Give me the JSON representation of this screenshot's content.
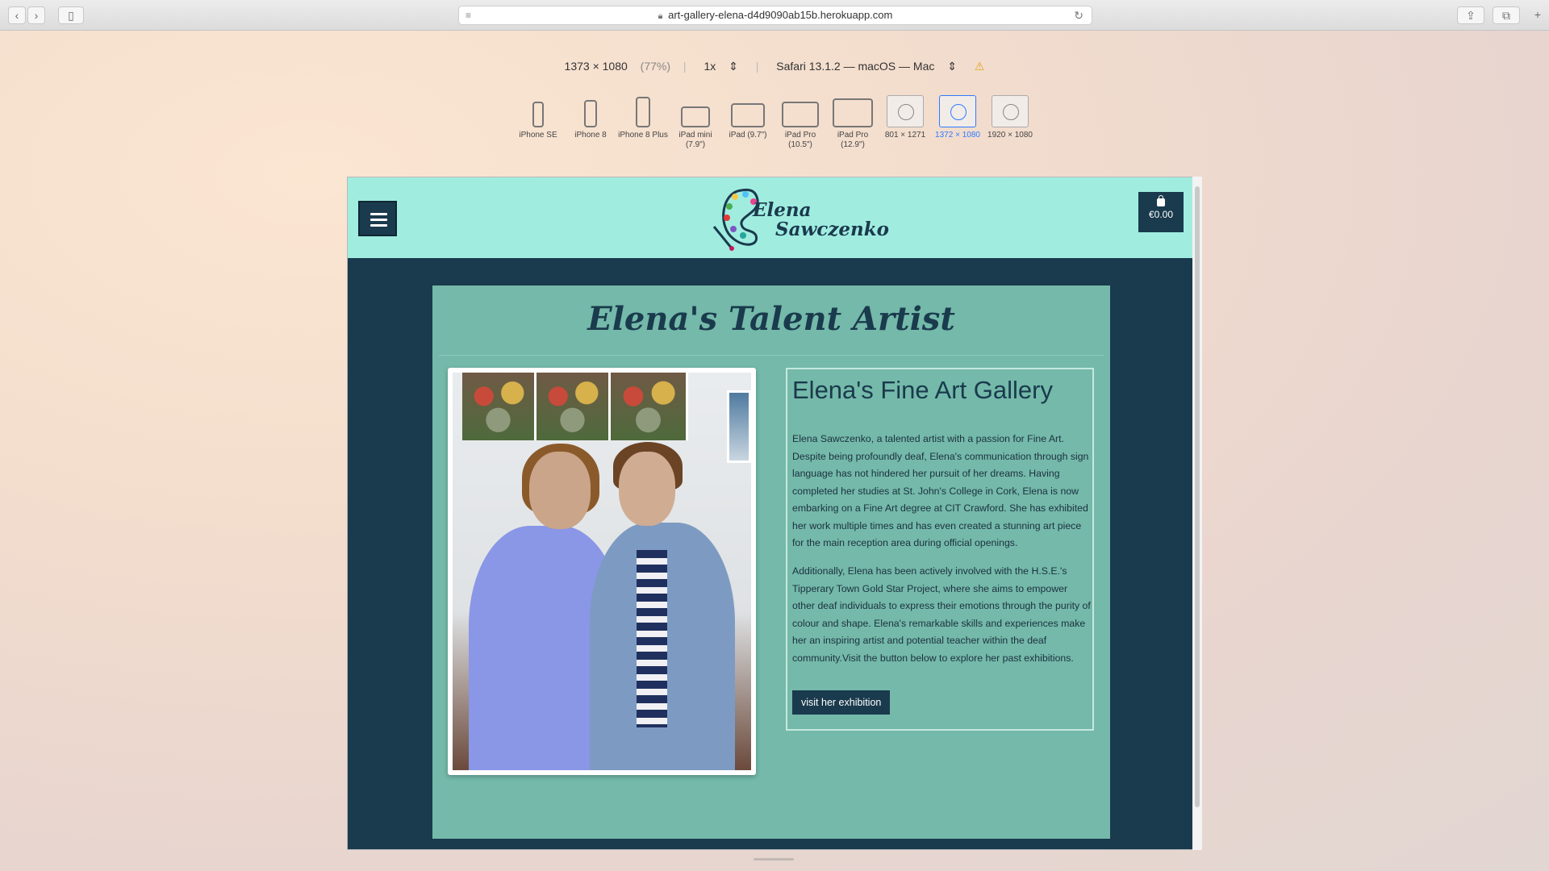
{
  "browser": {
    "url": "art-gallery-elena-d4d9090ab15b.herokuapp.com"
  },
  "responsive": {
    "dimensions": "1373 × 1080",
    "zoom": "(77%)",
    "scale": "1x",
    "user_agent": "Safari 13.1.2 — macOS — Mac",
    "devices": [
      {
        "label": "iPhone SE",
        "active": false
      },
      {
        "label": "iPhone 8",
        "active": false
      },
      {
        "label": "iPhone 8 Plus",
        "active": false
      },
      {
        "label": "iPad mini (7.9\")",
        "active": false
      },
      {
        "label": "iPad (9.7\")",
        "active": false
      },
      {
        "label": "iPad Pro (10.5\")",
        "active": false
      },
      {
        "label": "iPad Pro (12.9\")",
        "active": false
      },
      {
        "label": "801 × 1271",
        "active": false
      },
      {
        "label": "1372 × 1080",
        "active": true
      },
      {
        "label": "1920 × 1080",
        "active": false
      }
    ]
  },
  "site": {
    "logo": {
      "line1": "Elena",
      "line2": "Sawczenko"
    },
    "cart_total": "€0.00",
    "page_title": "Elena's Talent Artist",
    "gallery_heading": "Elena's Fine Art Gallery",
    "paragraph1": "Elena Sawczenko, a talented artist with a passion for Fine Art. Despite being profoundly deaf, Elena's communication through sign language has not hindered her pursuit of her dreams. Having completed her studies at St. John's College in Cork, Elena is now embarking on a Fine Art degree at CIT Crawford. She has exhibited her work multiple times and has even created a stunning art piece for the main reception area during official openings.",
    "paragraph2": "Additionally, Elena has been actively involved with the H.S.E.'s Tipperary Town Gold Star Project, where she aims to empower other deaf individuals to express their emotions through the purity of colour and shape. Elena's remarkable skills and experiences make her an inspiring artist and potential teacher within the deaf community.Visit the button below to explore her past exhibitions.",
    "visit_button": "visit her exhibition"
  },
  "colors": {
    "header_bg": "#a0ede0",
    "page_bg": "#1a3a4d",
    "panel_bg": "#74b9a9",
    "accent_blue": "#2f7bff"
  }
}
